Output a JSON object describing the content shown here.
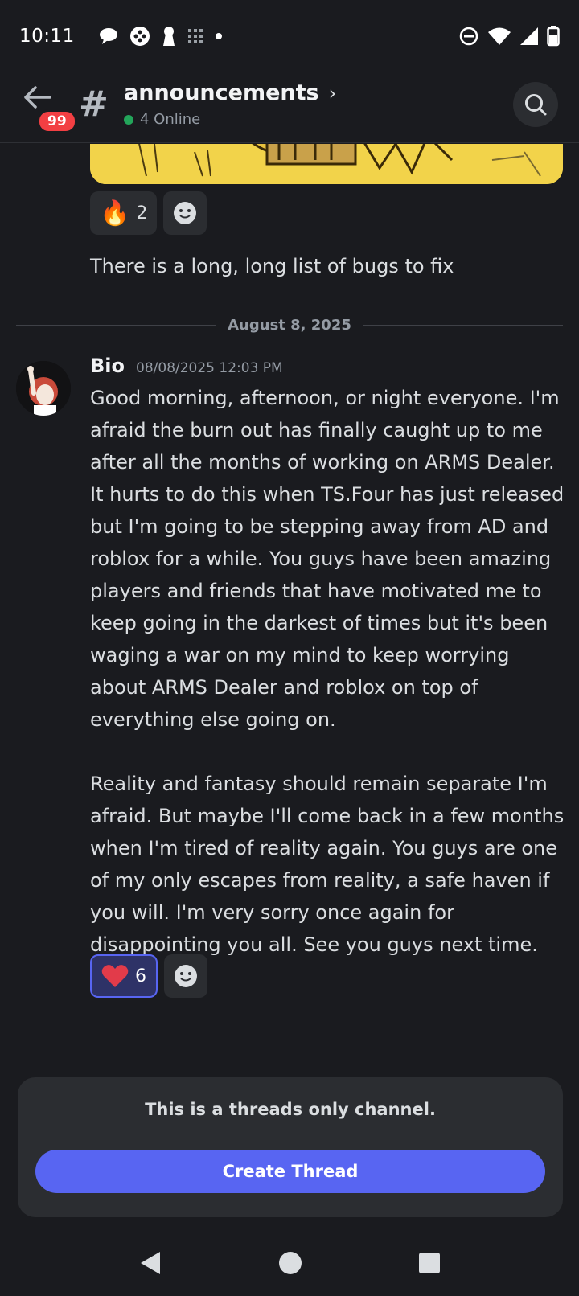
{
  "status_bar": {
    "time": "10:11"
  },
  "header": {
    "back_icon": "arrow-left-icon",
    "badge": "99",
    "hash": "#",
    "channel_name": "announcements",
    "online_text": "4 Online"
  },
  "messages": {
    "prev_reaction": {
      "emoji": "🔥",
      "count": "2"
    },
    "prev_text": "There is a long, long list of bugs to fix",
    "date_divider": "August 8, 2025",
    "author": "Bio",
    "timestamp": "08/08/2025 12:03 PM",
    "body": "Good morning, afternoon, or night everyone. I'm afraid the burn out has finally caught up to me after all the months of working on ARMS Dealer. It hurts to do this when TS.Four has just released but I'm going to be stepping away from AD and roblox for a while. You guys have been amazing players and friends that have motivated me to keep going in the darkest of times but it's been waging a war on my mind to keep worrying about ARMS Dealer and roblox on top of everything else going on.\n\nReality and fantasy should remain separate I'm afraid. But maybe I'll come back in a few months when I'm tired of reality again. You guys are one of my only escapes from reality, a safe haven if you will. I'm very sorry once again for disappointing you all. See you guys next time.",
    "heart_reaction": {
      "emoji": "❤",
      "count": "6"
    }
  },
  "composer": {
    "notice": "This is a threads only channel.",
    "button": "Create Thread"
  },
  "colors": {
    "accent": "#5865f2",
    "background": "#1a1b1f",
    "online": "#23a55a",
    "badge": "#f23f43"
  }
}
